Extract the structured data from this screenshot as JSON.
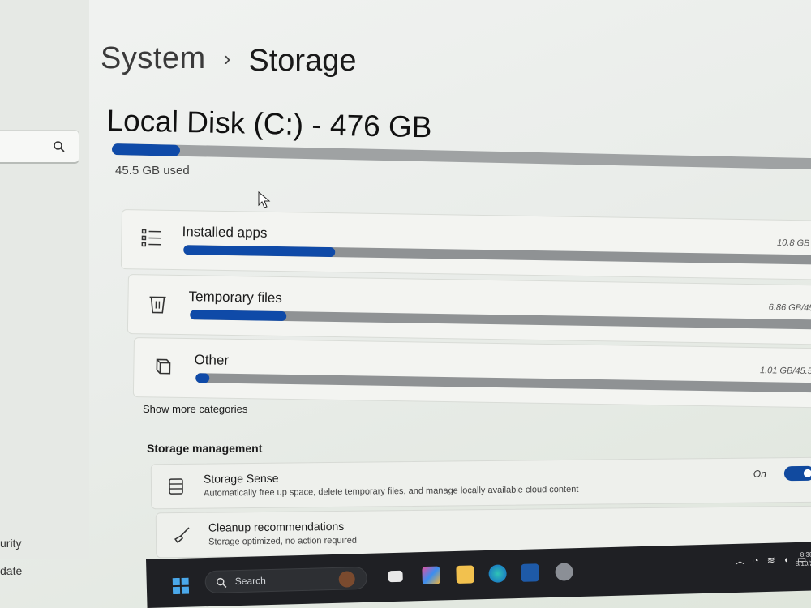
{
  "nav": {
    "search_icon": "search-icon",
    "items": [
      {
        "label": "urity"
      },
      {
        "label": "date"
      }
    ]
  },
  "breadcrumb": {
    "parent": "System",
    "separator": "›",
    "current": "Storage"
  },
  "disk": {
    "title": "Local Disk (C:) - 476 GB",
    "used_label": "45.5 GB used",
    "used_fraction": 0.096
  },
  "categories": [
    {
      "icon": "list-icon",
      "label": "Installed apps",
      "size": "10.8 GB",
      "fraction": 0.237
    },
    {
      "icon": "trash-icon",
      "label": "Temporary files",
      "size": "6.86 GB/45.",
      "fraction": 0.151
    },
    {
      "icon": "box-icon",
      "label": "Other",
      "size": "1.01 GB/45.5 G",
      "fraction": 0.022
    }
  ],
  "show_more": "Show more categories",
  "storage_management": {
    "title": "Storage management",
    "items": [
      {
        "icon": "storage-sense-icon",
        "title": "Storage Sense",
        "subtitle": "Automatically free up space, delete temporary files, and manage locally available cloud content",
        "toggle_label": "On",
        "toggle_on": true
      },
      {
        "icon": "broom-icon",
        "title": "Cleanup recommendations",
        "subtitle": "Storage optimized, no action required",
        "chevron": "›"
      }
    ]
  },
  "taskbar": {
    "search_placeholder": "Search",
    "clock_time": "8:38 AM",
    "clock_date": "8/10/2025",
    "colors": {
      "accent": "#0f4aa8",
      "taskbar": "#1f2024"
    }
  }
}
